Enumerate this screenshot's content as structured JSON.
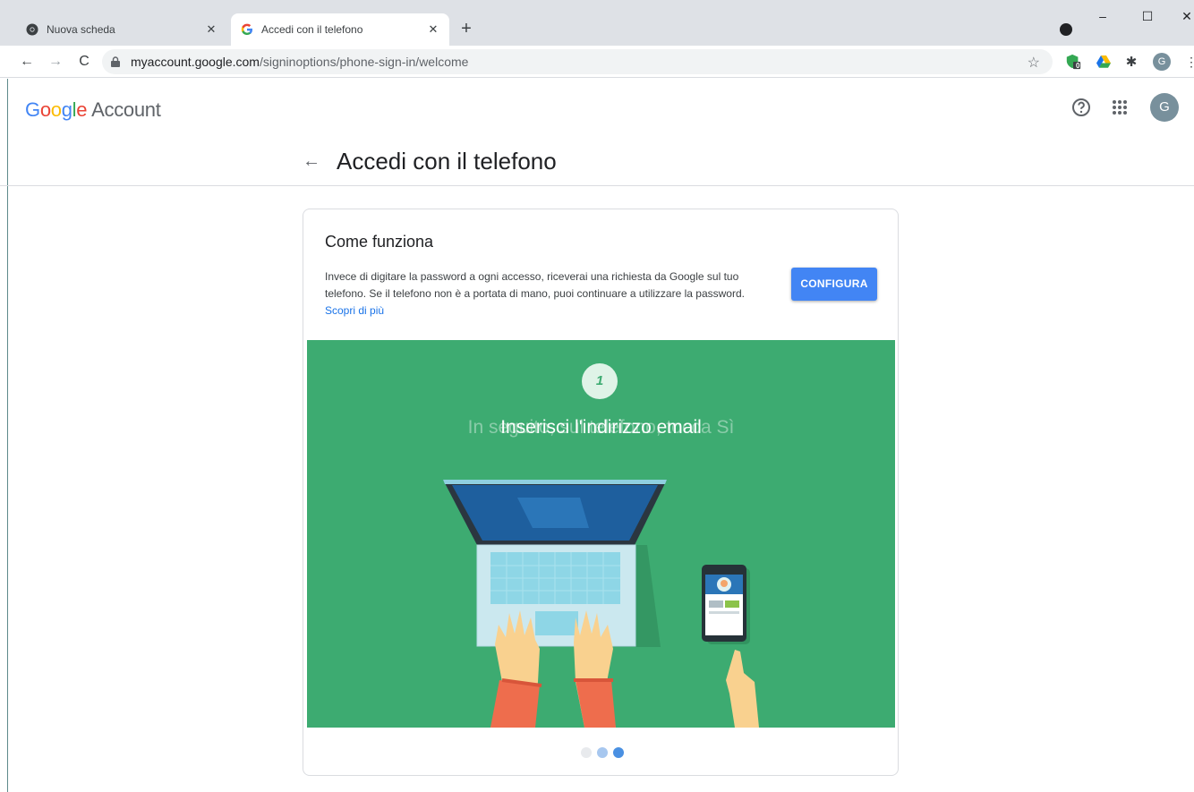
{
  "browser": {
    "tabs": [
      {
        "title": "Nuova scheda",
        "active": false
      },
      {
        "title": "Accedi con il telefono",
        "active": true
      }
    ],
    "new_tab_icon": "plus-icon",
    "url_host": "myaccount.google.com",
    "url_path": "/signinoptions/phone-sign-in/welcome",
    "extension_badge": "0"
  },
  "header": {
    "logo_letters": [
      "G",
      "o",
      "o",
      "g",
      "l",
      "e"
    ],
    "logo_product": "Account",
    "avatar_initial": "G"
  },
  "page": {
    "title": "Accedi con il telefono"
  },
  "card": {
    "title": "Come funziona",
    "description": "Invece di digitare la password a ogni accesso, riceverai una richiesta da Google sul tuo telefono. Se il telefono non è a portata di mano, puoi continuare a utilizzare la password.",
    "learn_more": "Scopri di più",
    "config_button": "CONFIGURA"
  },
  "slideshow": {
    "step_number": "1",
    "step_ghost_text": "In seguito, sul telefono, tocca Sì",
    "step_text": "Inserisci l'indirizzo email",
    "dots": [
      {
        "state": "inactive"
      },
      {
        "state": "partial"
      },
      {
        "state": "active"
      }
    ]
  },
  "colors": {
    "accent": "#4285f4",
    "illustration_bg": "#3dab71",
    "link": "#1a73e8"
  }
}
